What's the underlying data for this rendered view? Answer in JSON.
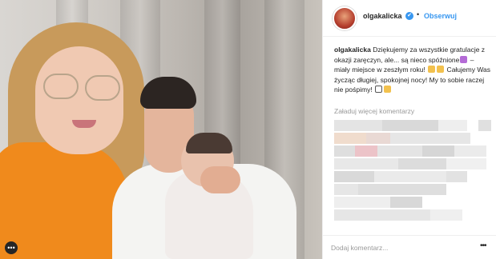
{
  "header": {
    "username": "olgakalicka",
    "verified_glyph": "✔",
    "separator": "•",
    "follow_label": "Obserwuj"
  },
  "caption": {
    "username": "olgakalicka",
    "line1": "Dziękujemy za wszystkie gratulacje z okazji zaręczyn, ale... są nieco spóźnione",
    "line2": " – miały miejsce w zeszłym roku! ",
    "line3": " Całujemy Was życząc długiej, spokojnej nocy! My to sobie raczej nie pośpimy! ",
    "emoji_1": "ring-emoji",
    "emoji_2": "laughing-emoji",
    "emoji_3": "box-emoji"
  },
  "comments": {
    "load_more": "Załaduj więcej komentarzy"
  },
  "comment_bar": {
    "placeholder": "Dodaj komentarz...",
    "more_glyph": "•••"
  },
  "photo": {
    "more_glyph": "•••"
  },
  "colors": {
    "accent": "#3897f0",
    "text": "#262626",
    "muted": "#999999",
    "border": "#efefef"
  }
}
